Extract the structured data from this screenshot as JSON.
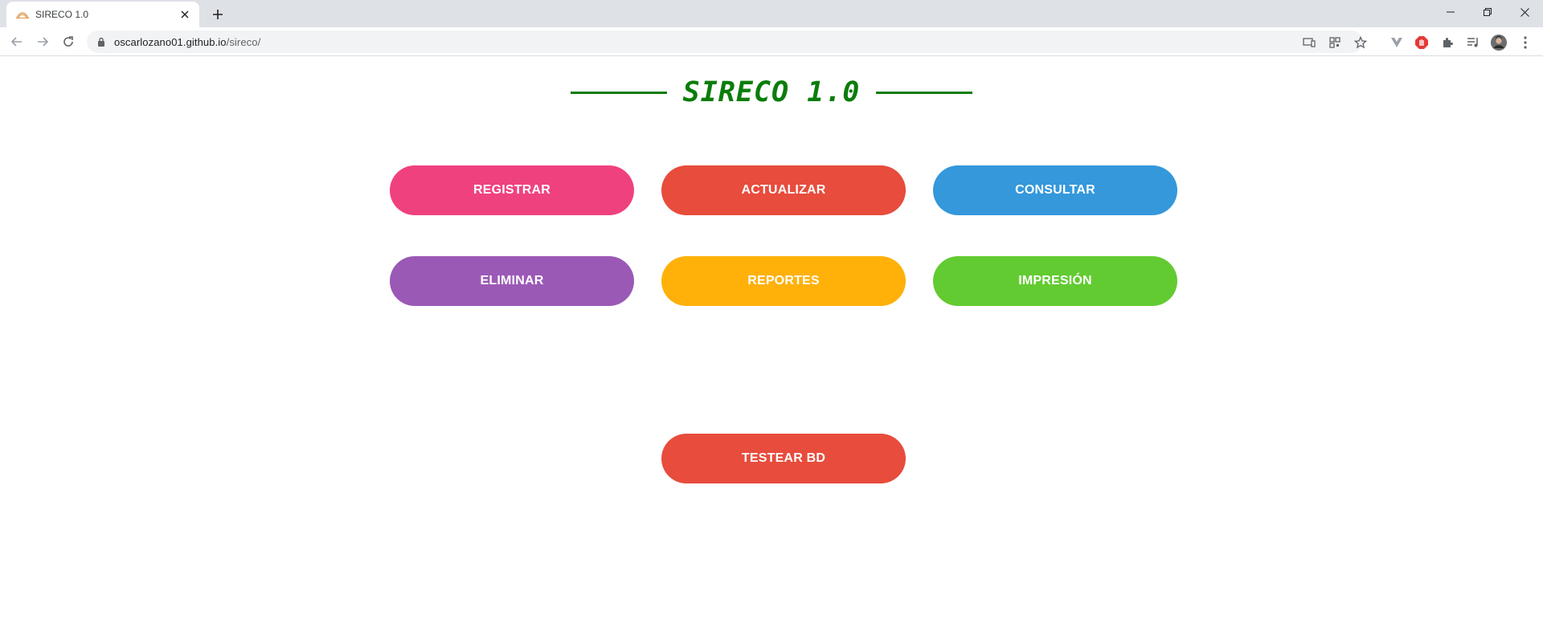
{
  "browser": {
    "tab_title": "SIRECO 1.0",
    "url_host": "oscarlozano01.github.io",
    "url_path": "/sireco/"
  },
  "page": {
    "title": "SIRECO 1.0",
    "title_color": "#0a7d0a"
  },
  "buttons": {
    "registrar": {
      "label": "REGISTRAR",
      "color": "#f0417f"
    },
    "actualizar": {
      "label": "ACTUALIZAR",
      "color": "#e74c3c"
    },
    "consultar": {
      "label": "CONSULTAR",
      "color": "#3498db"
    },
    "eliminar": {
      "label": "ELIMINAR",
      "color": "#9b59b6"
    },
    "reportes": {
      "label": "REPORTES",
      "color": "#ffb10a"
    },
    "impresion": {
      "label": "IMPRESIÓN",
      "color": "#62cb31"
    },
    "testear_bd": {
      "label": "TESTEAR BD",
      "color": "#e74c3c"
    }
  }
}
